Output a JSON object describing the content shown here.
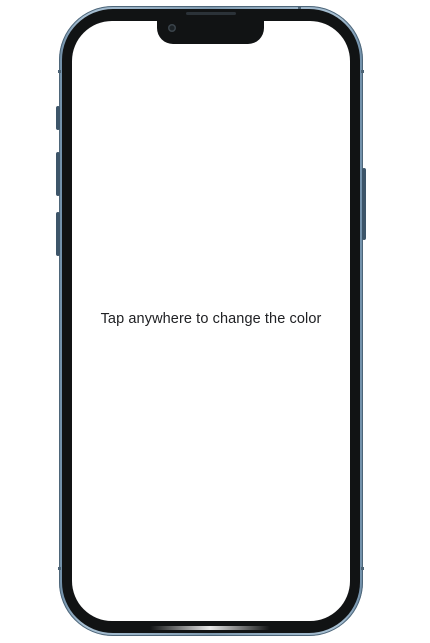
{
  "app": {
    "hint": "Tap anywhere to change the color",
    "background_color": "#ffffff",
    "text_color": "#202124"
  },
  "device": {
    "frame_color": "#8fa9bd",
    "bezel_color": "#111314"
  },
  "icons": {
    "camera": "front-camera-icon"
  }
}
